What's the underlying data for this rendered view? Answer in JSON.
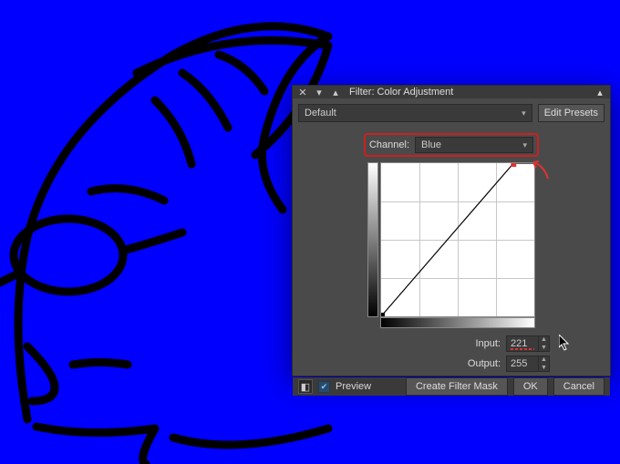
{
  "canvas": {
    "bg_color": "#0000FF"
  },
  "dialog": {
    "title": "Filter: Color Adjustment",
    "preset": {
      "selected": "Default",
      "edit_label": "Edit Presets"
    },
    "channel": {
      "label": "Channel:",
      "selected": "Blue"
    },
    "curve": {
      "input": {
        "label": "Input:",
        "value": "221"
      },
      "output": {
        "label": "Output:",
        "value": "255"
      }
    },
    "footer": {
      "preview_label": "Preview",
      "preview_checked": true,
      "buttons": {
        "create_filter_mask": "Create Filter Mask",
        "ok": "OK",
        "cancel": "Cancel"
      }
    }
  }
}
